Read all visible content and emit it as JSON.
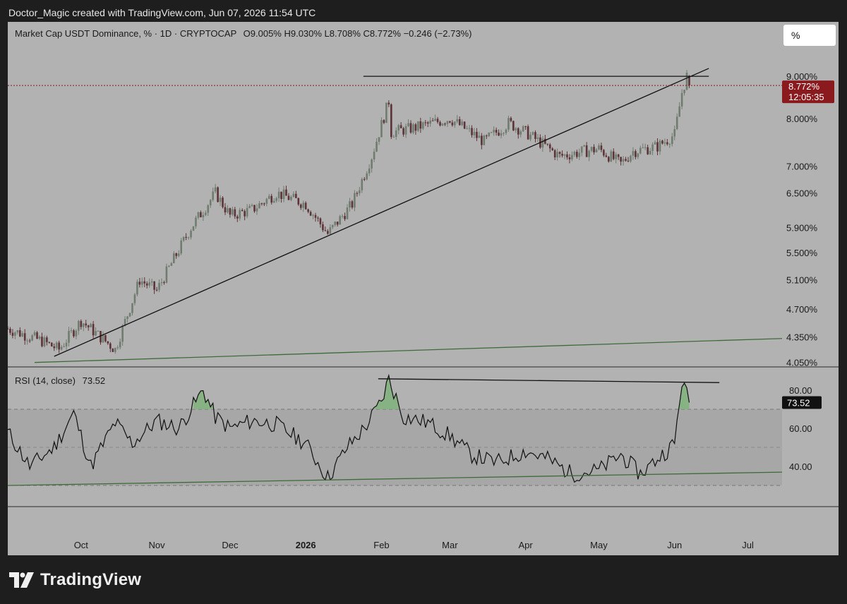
{
  "header": {
    "caption": "Doctor_Magic created with TradingView.com, Jun 07, 2026 11:54 UTC"
  },
  "legend": {
    "symbol": "Market Cap USDT Dominance, % · 1D · CRYPTOCAP",
    "ohlc": "O9.005% H9.030% L8.708% C8.772% −0.246 (−2.73%)"
  },
  "scale_button": {
    "label": "%"
  },
  "price_axis": {
    "ticks": [
      "9.000%",
      "8.000%",
      "7.000%",
      "6.500%",
      "5.900%",
      "5.500%",
      "5.100%",
      "4.700%",
      "4.350%",
      "4.050%"
    ],
    "last_price": "8.772%",
    "countdown": "12:05:35"
  },
  "rsi": {
    "label": "RSI (14, close)",
    "value": "73.52",
    "ticks": [
      "80.00",
      "60.00",
      "40.00"
    ]
  },
  "time_axis": {
    "labels": [
      "Oct",
      "Nov",
      "Dec",
      "2026",
      "Feb",
      "Mar",
      "Apr",
      "May",
      "Jun",
      "Jul"
    ]
  },
  "brand": {
    "name": "TradingView"
  },
  "colors": {
    "up": "#6f7c6f",
    "down": "#5c3338",
    "price_tag": "#8b1a1f",
    "green_line": "#3f6b3a",
    "rsi_fill": "#7fb27a"
  },
  "chart_data": [
    {
      "type": "candlestick",
      "title": "Market Cap USDT Dominance, % · 1D · CRYPTOCAP",
      "y_scale": "log",
      "ylim": [
        4.0,
        9.4
      ],
      "x_range": [
        "2025-09-01",
        "2026-07-15"
      ],
      "x": [
        "2025-09-01",
        "2025-09-15",
        "2025-09-22",
        "2025-10-01",
        "2025-10-15",
        "2025-10-25",
        "2025-11-01",
        "2025-11-15",
        "2025-11-25",
        "2025-12-01",
        "2025-12-10",
        "2025-12-20",
        "2026-01-01",
        "2026-01-10",
        "2026-01-20",
        "2026-01-28",
        "2026-02-04",
        "2026-02-05",
        "2026-02-15",
        "2026-03-01",
        "2026-03-15",
        "2026-03-25",
        "2026-04-01",
        "2026-04-15",
        "2026-04-25",
        "2026-05-01",
        "2026-05-10",
        "2026-05-15",
        "2026-05-25",
        "2026-06-01",
        "2026-06-04",
        "2026-06-06",
        "2026-06-07"
      ],
      "values": [
        4.45,
        4.3,
        4.2,
        4.55,
        4.2,
        5.1,
        4.95,
        5.9,
        6.5,
        6.1,
        6.2,
        6.5,
        6.3,
        5.8,
        6.3,
        7.2,
        8.4,
        7.7,
        7.8,
        8.0,
        7.5,
        7.9,
        7.7,
        7.2,
        7.3,
        7.35,
        7.05,
        7.3,
        7.4,
        7.65,
        8.6,
        9.005,
        8.772
      ],
      "last": {
        "open": 9.005,
        "high": 9.03,
        "low": 8.708,
        "close": 8.772,
        "change": -0.246,
        "change_pct": -2.73
      },
      "annotations": [
        {
          "kind": "horizontal-resistance",
          "y": 9.0,
          "x_from": "2026-02-04",
          "x_to": "2026-06-15"
        },
        {
          "kind": "rising-trendline",
          "from": [
            "2025-09-20",
            4.12
          ],
          "to": [
            "2026-06-15",
            9.2
          ]
        },
        {
          "kind": "long-term-support",
          "from": [
            "2025-09-12",
            4.05
          ],
          "to": [
            "2026-07-15",
            4.33
          ]
        }
      ]
    },
    {
      "type": "line",
      "title": "RSI (14, close)",
      "ylim": [
        20,
        90
      ],
      "reference_levels": [
        70,
        50,
        30
      ],
      "x": [
        "2025-09-01",
        "2025-09-10",
        "2025-09-20",
        "2025-09-28",
        "2025-10-05",
        "2025-10-15",
        "2025-10-22",
        "2025-11-01",
        "2025-11-10",
        "2025-11-20",
        "2025-11-25",
        "2025-12-01",
        "2025-12-10",
        "2025-12-20",
        "2026-01-01",
        "2026-01-10",
        "2026-01-18",
        "2026-01-25",
        "2026-02-01",
        "2026-02-04",
        "2026-02-10",
        "2026-02-20",
        "2026-03-01",
        "2026-03-10",
        "2026-03-20",
        "2026-04-01",
        "2026-04-10",
        "2026-04-20",
        "2026-05-01",
        "2026-05-10",
        "2026-05-18",
        "2026-05-25",
        "2026-06-01",
        "2026-06-04",
        "2026-06-07"
      ],
      "values": [
        58,
        40,
        50,
        68,
        40,
        63,
        52,
        64,
        60,
        80,
        66,
        60,
        64,
        62,
        52,
        34,
        50,
        60,
        74,
        86,
        66,
        63,
        56,
        46,
        42,
        48,
        44,
        36,
        38,
        46,
        36,
        44,
        52,
        85,
        73.52
      ],
      "annotations": [
        {
          "kind": "bearish-divergence",
          "from": [
            "2026-02-04",
            86
          ],
          "to": [
            "2026-06-15",
            84
          ]
        },
        {
          "kind": "support",
          "from": [
            "2025-09-01",
            30
          ],
          "to": [
            "2026-07-15",
            37
          ]
        }
      ]
    }
  ]
}
